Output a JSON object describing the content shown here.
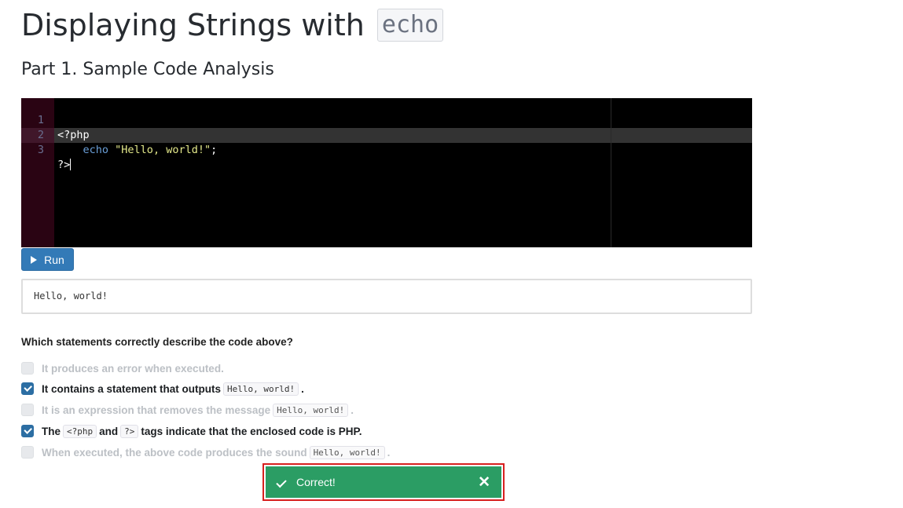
{
  "header": {
    "title": "Displaying Strings with",
    "title_code": "echo",
    "subtitle": "Part 1. Sample Code Analysis"
  },
  "editor": {
    "lines": [
      {
        "number": "1",
        "text": "<?php"
      },
      {
        "number": "2",
        "indent": "    ",
        "keyword": "echo",
        "string": "\"Hello, world!\"",
        "end": ";"
      },
      {
        "number": "3",
        "text": "?>"
      }
    ]
  },
  "run_button": {
    "label": "Run",
    "icon": "play-icon"
  },
  "output": {
    "text": "Hello, world!"
  },
  "question": {
    "text": "Which statements correctly describe the code above?",
    "options": [
      {
        "checked": false,
        "text": "It produces an error when executed."
      },
      {
        "checked": true,
        "pre": "It contains a statement that outputs",
        "code": "Hello, world!",
        "post": "."
      },
      {
        "checked": false,
        "pre": "It is an expression that removes the message",
        "code": "Hello, world!",
        "post": "."
      },
      {
        "checked": true,
        "pre": "The",
        "code1": "<?php",
        "mid": "and",
        "code2": "?>",
        "post": "tags indicate that the enclosed code is PHP."
      },
      {
        "checked": false,
        "pre": "When executed, the above code produces the sound",
        "code": "Hello, world!",
        "post": "."
      }
    ]
  },
  "toast": {
    "message": "Correct!",
    "close_glyph": "✕",
    "status_color": "#2b9d64",
    "highlight_color": "#d7201f"
  }
}
